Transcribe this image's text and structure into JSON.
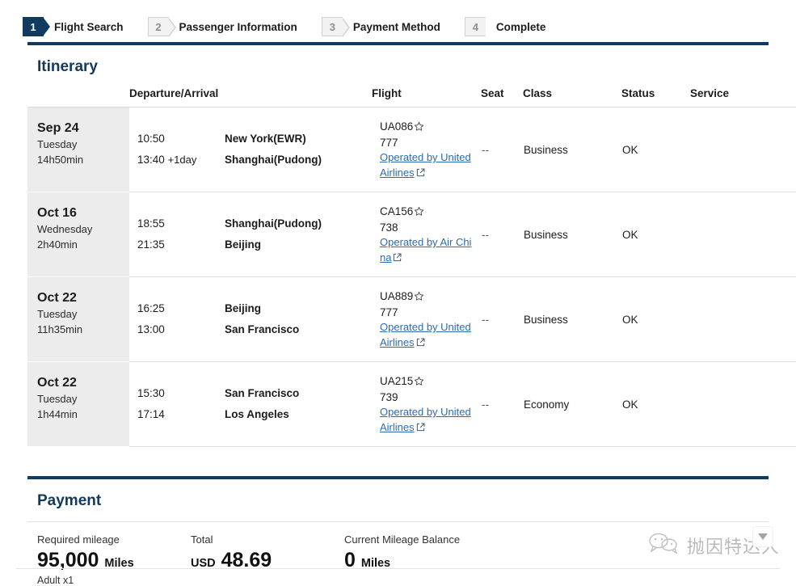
{
  "steps": [
    {
      "num": "1",
      "label": "Flight Search",
      "state": "active"
    },
    {
      "num": "2",
      "label": "Passenger Information",
      "state": "inactive"
    },
    {
      "num": "3",
      "label": "Payment Method",
      "state": "inactive"
    },
    {
      "num": "4",
      "label": "Complete",
      "state": "inactive"
    }
  ],
  "itinerary": {
    "title": "Itinerary",
    "columns": {
      "date": "",
      "departure_arrival": "Departure/Arrival",
      "flight": "Flight",
      "seat": "Seat",
      "class": "Class",
      "status": "Status",
      "service": "Service"
    },
    "rows": [
      {
        "date": "Sep 24",
        "weekday": "Tuesday",
        "duration": "14h50min",
        "dep_time": "10:50",
        "dep_day_offset": "",
        "dep_place": "New York(EWR)",
        "arr_time": "13:40",
        "arr_day_offset": "+1day",
        "arr_place": "Shanghai(Pudong)",
        "flight_no": "UA086",
        "aircraft": "777",
        "operated_by": "Operated by United Airlines",
        "seat": "--",
        "class": "Business",
        "status": "OK",
        "service": ""
      },
      {
        "date": "Oct 16",
        "weekday": "Wednesday",
        "duration": "2h40min",
        "dep_time": "18:55",
        "dep_day_offset": "",
        "dep_place": "Shanghai(Pudong)",
        "arr_time": "21:35",
        "arr_day_offset": "",
        "arr_place": "Beijing",
        "flight_no": "CA156",
        "aircraft": "738",
        "operated_by": "Operated by Air China",
        "seat": "--",
        "class": "Business",
        "status": "OK",
        "service": ""
      },
      {
        "date": "Oct 22",
        "weekday": "Tuesday",
        "duration": "11h35min",
        "dep_time": "16:25",
        "dep_day_offset": "",
        "dep_place": "Beijing",
        "arr_time": "13:00",
        "arr_day_offset": "",
        "arr_place": "San Francisco",
        "flight_no": "UA889",
        "aircraft": "777",
        "operated_by": "Operated by United Airlines",
        "seat": "--",
        "class": "Business",
        "status": "OK",
        "service": ""
      },
      {
        "date": "Oct 22",
        "weekday": "Tuesday",
        "duration": "1h44min",
        "dep_time": "15:30",
        "dep_day_offset": "",
        "dep_place": "San Francisco",
        "arr_time": "17:14",
        "arr_day_offset": "",
        "arr_place": "Los Angeles",
        "flight_no": "UA215",
        "aircraft": "739",
        "operated_by": "Operated by United Airlines",
        "seat": "--",
        "class": "Economy",
        "status": "OK",
        "service": ""
      }
    ]
  },
  "payment": {
    "title": "Payment",
    "required_mileage": {
      "label": "Required mileage",
      "amount": "95,000",
      "unit": "Miles",
      "note": "Adult x1"
    },
    "total": {
      "label": "Total",
      "currency": "USD",
      "amount": "48.69"
    },
    "balance": {
      "label": "Current Mileage Balance",
      "amount": "0",
      "unit": "Miles"
    }
  },
  "watermark": {
    "text": "抛因特达人",
    "icon": "wechat-icon",
    "caret": "chevron-down-icon"
  },
  "colors": {
    "accent_navy": "#123a5e",
    "link_blue": "#2b6cb0",
    "row_date_bg": "#ececec",
    "step_inactive_bg": "#f2f2f2"
  }
}
